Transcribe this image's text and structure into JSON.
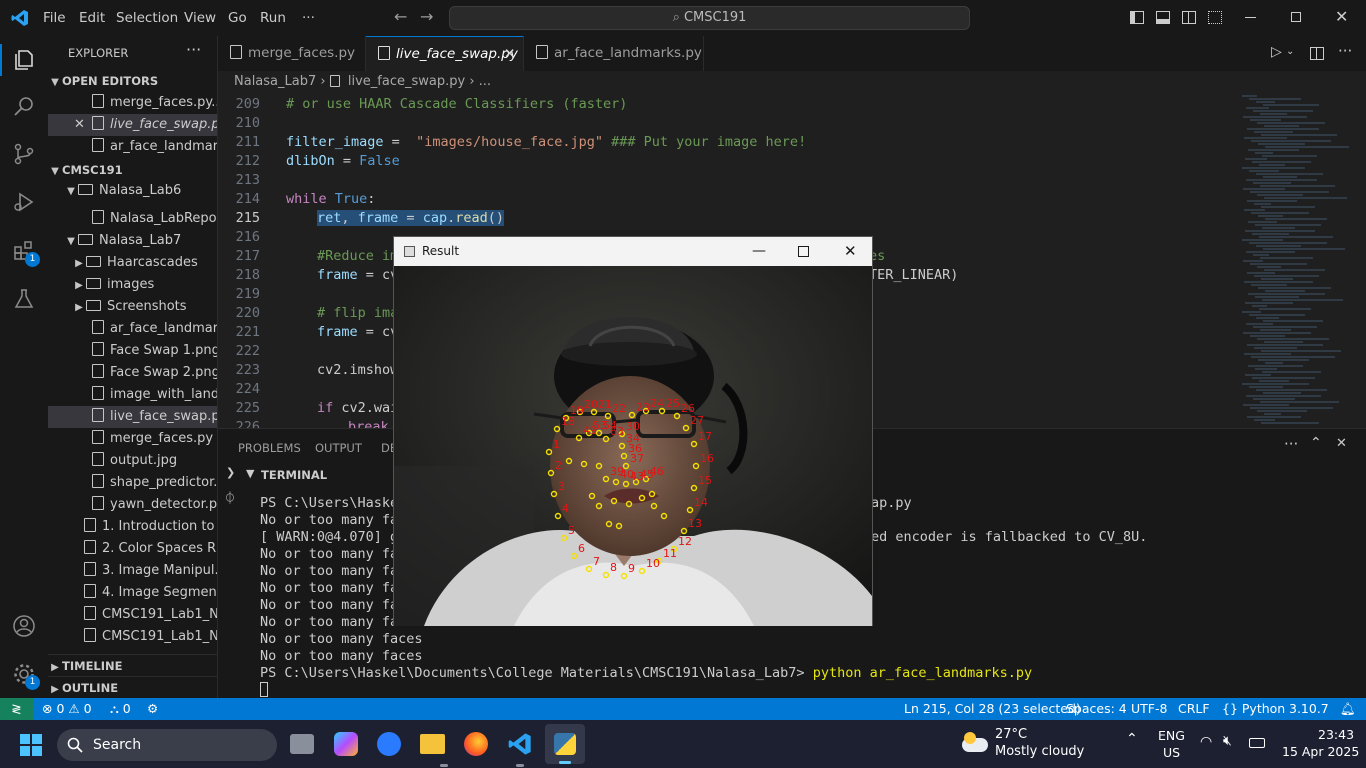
{
  "titlebar": {
    "menus": [
      "File",
      "Edit",
      "Selection",
      "View",
      "Go",
      "Run",
      "···"
    ],
    "command_center": "CMSC191"
  },
  "activity_badges": {
    "extensions": "1",
    "manage": "1"
  },
  "sidebar": {
    "title": "EXPLORER",
    "open_editors_header": "OPEN EDITORS",
    "open_editors": [
      {
        "label": "merge_faces.py..."
      },
      {
        "label": "live_face_swap.p..."
      },
      {
        "label": "ar_face_landmar..."
      }
    ],
    "workspace_header": "CMSC191",
    "tree": [
      {
        "label": "Nalasa_Lab6",
        "type": "folder-open"
      },
      {
        "label": "Nalasa_LabRepo...",
        "type": "file"
      },
      {
        "label": "Nalasa_Lab7",
        "type": "folder-open"
      },
      {
        "label": "Haarcascades",
        "type": "folder"
      },
      {
        "label": "images",
        "type": "folder"
      },
      {
        "label": "Screenshots",
        "type": "folder"
      },
      {
        "label": "ar_face_landmar...",
        "type": "file"
      },
      {
        "label": "Face Swap 1.png",
        "type": "file"
      },
      {
        "label": "Face Swap 2.png",
        "type": "file"
      },
      {
        "label": "image_with_land...",
        "type": "file"
      },
      {
        "label": "live_face_swap.py",
        "type": "file"
      },
      {
        "label": "merge_faces.py",
        "type": "file"
      },
      {
        "label": "output.jpg",
        "type": "file"
      },
      {
        "label": "shape_predictor...",
        "type": "file"
      },
      {
        "label": "yawn_detector.py",
        "type": "file"
      },
      {
        "label": "1. Introduction to ...",
        "type": "file"
      },
      {
        "label": "2. Color Spaces R...",
        "type": "file"
      },
      {
        "label": "3. Image Manipul...",
        "type": "file"
      },
      {
        "label": "4. Image Segment...",
        "type": "file"
      },
      {
        "label": "CMSC191_Lab1_N...",
        "type": "file"
      },
      {
        "label": "CMSC191_Lab1_N...",
        "type": "file"
      }
    ],
    "timeline_header": "TIMELINE",
    "outline_header": "OUTLINE"
  },
  "tabs": [
    {
      "label": "merge_faces.py"
    },
    {
      "label": "live_face_swap.py"
    },
    {
      "label": "ar_face_landmarks.py"
    }
  ],
  "breadcrumb": {
    "folder": "Nalasa_Lab7",
    "file": "live_face_swap.py",
    "more": "..."
  },
  "editor": {
    "line_numbers": [
      "209",
      "210",
      "211",
      "212",
      "213",
      "214",
      "215",
      "216",
      "217",
      "218",
      "219",
      "220",
      "221",
      "222",
      "223",
      "224",
      "225",
      "226"
    ],
    "l209": "# or use HAAR Cascade Classifiers (faster)",
    "l211a": "filter_image",
    "l211b": " =  ",
    "l211c": "\"images/house_face.jpg\"",
    "l211d": " ### Put your image here!",
    "l212a": "dlibOn",
    "l212b": " = ",
    "l212c": "False",
    "l214a": "while",
    "l214b": " True",
    "l214c": ":",
    "l215a": "ret",
    "l215b": ", ",
    "l215c": "frame",
    "l215d": " = ",
    "l215e": "cap",
    "l215f": ".",
    "l215g": "read",
    "l215h": "()",
    "l217": "#Reduce im",
    "l217r": "es",
    "l218a": "frame",
    "l218b": " = cv",
    "l218r": "TER_LINEAR)",
    "l220": "# flip ima",
    "l221a": "frame",
    "l221b": " = cv",
    "l223": "cv2.imshow",
    "l225a": "if",
    "l225b": " cv2.wai",
    "l226": "break"
  },
  "panel": {
    "tabs": [
      "PROBLEMS",
      "OUTPUT",
      "DE"
    ],
    "terminal_header": "TERMINAL",
    "terminal_lines": [
      "PS C:\\Users\\Haskel\\",
      "No or too many face",
      "[ WARN:0@4.070] glo",
      "No or too many face",
      "No or too many face",
      "No or too many face",
      "No or too many face",
      "No or too many face",
      "No or too many faces",
      "No or too many faces"
    ],
    "terminal_right_1": "ap.py",
    "terminal_right_2": "ed encoder is fallbacked to CV_8U.",
    "prompt": "PS C:\\Users\\Haskel\\Documents\\College Materials\\CMSC191\\Nalasa_Lab7> ",
    "command": "python ar_face_landmarks.py"
  },
  "result_window": {
    "title": "Result",
    "landmark_labels": [
      {
        "t": "1"
      },
      {
        "t": "2"
      },
      {
        "t": "3"
      },
      {
        "t": "4"
      },
      {
        "t": "5"
      },
      {
        "t": "6"
      },
      {
        "t": "7"
      },
      {
        "t": "8"
      },
      {
        "t": "9"
      },
      {
        "t": "10"
      },
      {
        "t": "11"
      },
      {
        "t": "12"
      },
      {
        "t": "13"
      },
      {
        "t": "14"
      },
      {
        "t": "15"
      },
      {
        "t": "16"
      },
      {
        "t": "17"
      },
      {
        "t": "18"
      },
      {
        "t": "19"
      },
      {
        "t": "20"
      },
      {
        "t": "21"
      },
      {
        "t": "22"
      },
      {
        "t": "23"
      },
      {
        "t": "24"
      },
      {
        "t": "25"
      },
      {
        "t": "26"
      },
      {
        "t": "27"
      },
      {
        "t": "30"
      },
      {
        "t": "34"
      },
      {
        "t": "36"
      },
      {
        "t": "37"
      },
      {
        "t": "39"
      },
      {
        "t": "40"
      },
      {
        "t": "43"
      },
      {
        "t": "45"
      },
      {
        "t": "46"
      },
      {
        "t": "49"
      },
      {
        "t": "53"
      },
      {
        "t": "54"
      },
      {
        "t": "63"
      }
    ]
  },
  "status": {
    "errors": "0",
    "warnings": "0",
    "ports": "0",
    "position": "Ln 215, Col 28 (23 selected)",
    "spaces": "Spaces: 4",
    "encoding": "UTF-8",
    "eol": "CRLF",
    "language": "Python",
    "version": "3.10.7"
  },
  "taskbar": {
    "search": "Search",
    "weather_temp": "27°C",
    "weather_desc": "Mostly cloudy",
    "lang1": "ENG",
    "lang2": "US",
    "time": "23:43",
    "date": "15 Apr 2025"
  },
  "colors": {
    "accent": "#0078d4",
    "editor_bg": "#1f1f1f",
    "sidebar_bg": "#181818",
    "landmark_dot": "#f5e000",
    "landmark_num": "#e31414"
  }
}
